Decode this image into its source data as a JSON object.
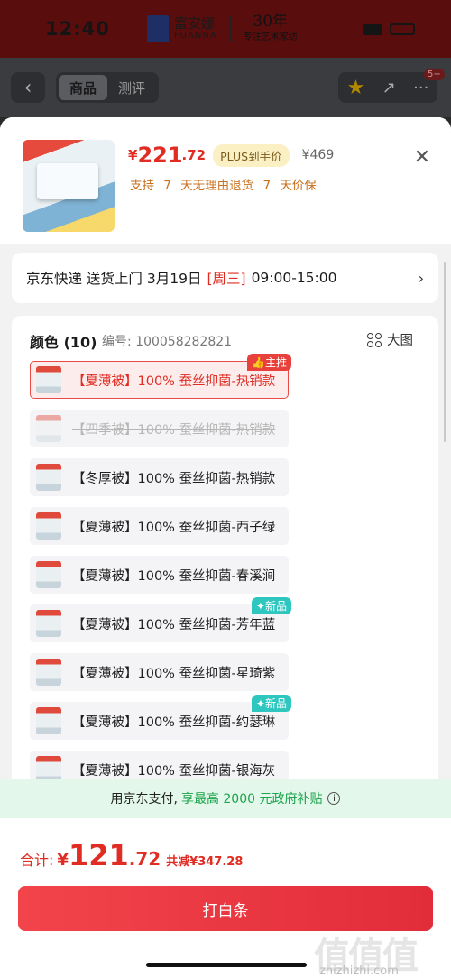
{
  "status_bar": {
    "time": "12:40",
    "brand_cn": "富安娜",
    "brand_en": "FUANNA",
    "brand_30": "30年",
    "brand_slogan": "专注艺术家纺"
  },
  "nav": {
    "back_icon": "chevron-left-icon",
    "tabs": [
      {
        "label": "商品",
        "active": true
      },
      {
        "label": "测评",
        "active": false
      }
    ],
    "cart_badge": "5+"
  },
  "product": {
    "price_symbol": "¥",
    "price_int": "221",
    "price_dec": ".72",
    "plus_badge": "PLUS到手价",
    "orig_price": "¥469",
    "guarantee": "支持 7 天无理由退货   7 天价保"
  },
  "delivery": {
    "text": "京东快递 送货上门 3月19日",
    "weekday": "[周三]",
    "time": "09:00-15:00"
  },
  "colors": {
    "title": "颜色 (10)",
    "sku": "编号: 100058282821",
    "big_image_label": "大图",
    "options": [
      {
        "label": "【夏薄被】100% 蚕丝抑菌-热销款",
        "state": "selected",
        "tag": "主推",
        "tag_type": "hot"
      },
      {
        "label": "【四季被】100% 蚕丝抑菌-热销款",
        "state": "disabled",
        "tag": "",
        "tag_type": ""
      },
      {
        "label": "【冬厚被】100% 蚕丝抑菌-热销款",
        "state": "normal",
        "tag": "",
        "tag_type": ""
      },
      {
        "label": "【夏薄被】100% 蚕丝抑菌-西子绿",
        "state": "normal",
        "tag": "",
        "tag_type": ""
      },
      {
        "label": "【夏薄被】100% 蚕丝抑菌-春溪涧",
        "state": "normal",
        "tag": "",
        "tag_type": ""
      },
      {
        "label": "【夏薄被】100% 蚕丝抑菌-芳年蓝",
        "state": "normal",
        "tag": "新品",
        "tag_type": "new"
      },
      {
        "label": "【夏薄被】100% 蚕丝抑菌-星琦紫",
        "state": "normal",
        "tag": "",
        "tag_type": ""
      },
      {
        "label": "【夏薄被】100% 蚕丝抑菌-约瑟琳",
        "state": "normal",
        "tag": "新品",
        "tag_type": "new"
      },
      {
        "label": "【夏薄被】100% 蚕丝抑菌-银海灰",
        "state": "normal",
        "tag": "",
        "tag_type": ""
      }
    ]
  },
  "subsidy": {
    "text": "用京东支付,",
    "highlight": "享最高 2000 元政府补贴"
  },
  "footer": {
    "total_label": "合计:",
    "total_symbol": "¥",
    "total_int": "121",
    "total_dec": ".72",
    "total_save": "共减¥347.28",
    "pay_button": "打白条",
    "watermark": "值值值",
    "watermark_url": "zhizhizhi.com"
  },
  "colors_theme": {
    "accent": "#e02c22",
    "plus_bg": "#fbf0c4",
    "new_tag": "#2ec7c0",
    "subsidy_bg": "#e3f7ea"
  }
}
